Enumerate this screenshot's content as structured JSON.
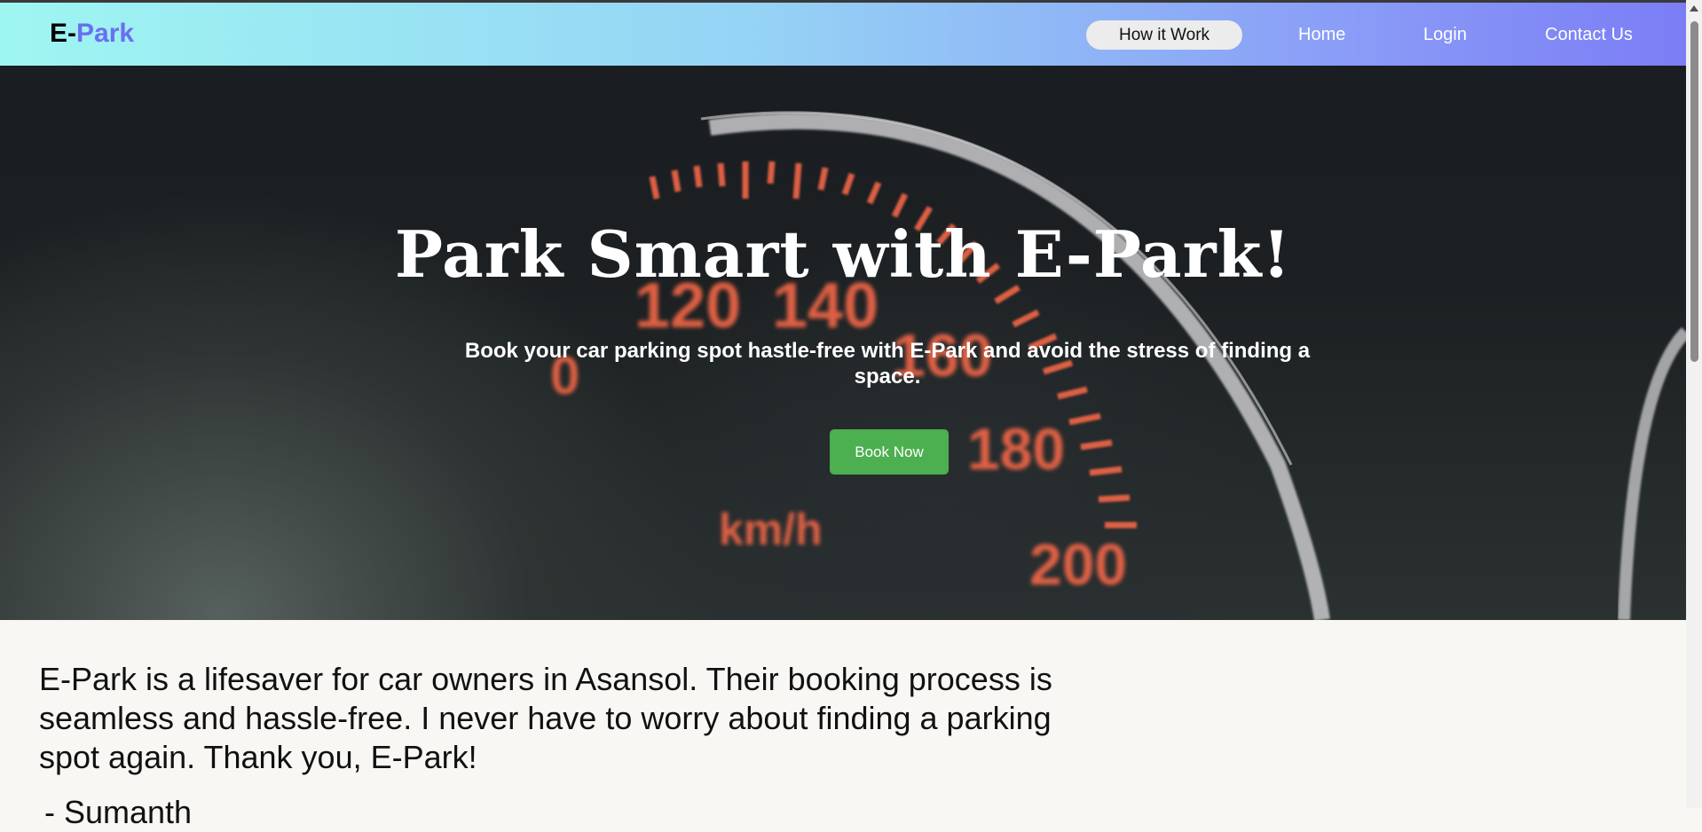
{
  "brand": {
    "first": "E-",
    "second": "Park"
  },
  "nav": {
    "how_it_works": "How it Work",
    "home": "Home",
    "login": "Login",
    "contact": "Contact Us"
  },
  "hero": {
    "title": "Park Smart with E-Park!",
    "subtitle": "Book your car parking spot hastle-free with E-Park and avoid the stress of finding a space.",
    "cta": "Book Now",
    "background_image": {
      "speed_labels": [
        "0",
        "120",
        "140",
        "160",
        "180",
        "200"
      ],
      "unit": "km/h"
    }
  },
  "testimonial": {
    "quote": "E-Park is a lifesaver for car owners in Asansol. Their booking process is seamless and hassle-free. I never have to worry about finding a parking spot again. Thank you, E-Park!",
    "author": "- Sumanth"
  },
  "colors": {
    "brand_accent": "#6b6ef0",
    "cta_green": "#4caf50",
    "nav_gradient_start": "#9ef6f1",
    "nav_gradient_end": "#7b7df5",
    "gauge_orange": "#ff6b4a"
  }
}
